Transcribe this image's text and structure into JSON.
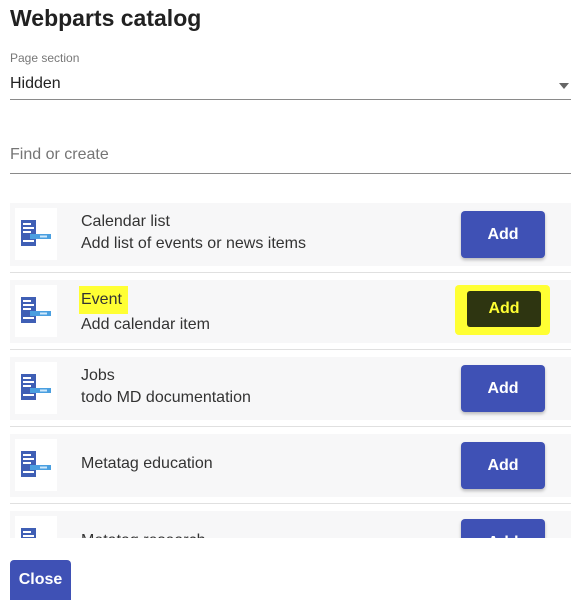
{
  "dialog": {
    "title": "Webparts catalog",
    "close_label": "Close"
  },
  "page_section": {
    "label": "Page section",
    "value": "Hidden"
  },
  "search": {
    "placeholder": "Find or create"
  },
  "webparts": [
    {
      "name": "Calendar list",
      "description": "Add list of events or news items",
      "add_label": "Add"
    },
    {
      "name": "Event",
      "description": "Add calendar item",
      "add_label": "Add"
    },
    {
      "name": "Jobs",
      "description": "todo MD documentation",
      "add_label": "Add"
    },
    {
      "name": "Metatag education",
      "description": "",
      "add_label": "Add"
    },
    {
      "name": "Metatag research",
      "description": "",
      "add_label": "Add"
    }
  ],
  "colors": {
    "primary": "#3f51b5",
    "highlight": "#ffff33"
  },
  "icons": {
    "webpart": "webpart-icon",
    "dropdown": "chevron-down-icon"
  }
}
